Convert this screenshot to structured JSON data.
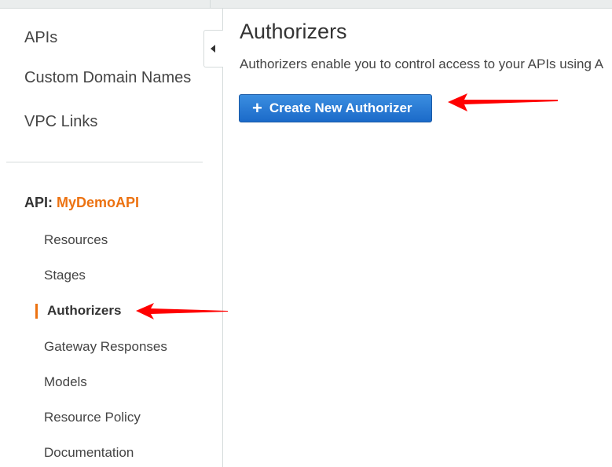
{
  "sidebar": {
    "top_links": [
      "APIs",
      "Custom Domain Names",
      "VPC Links"
    ],
    "api_prefix": "API:",
    "api_name": "MyDemoAPI",
    "sub_items": [
      "Resources",
      "Stages",
      "Authorizers",
      "Gateway Responses",
      "Models",
      "Resource Policy",
      "Documentation"
    ],
    "active_item": "Authorizers"
  },
  "main": {
    "title": "Authorizers",
    "description": "Authorizers enable you to control access to your APIs using A",
    "create_button_label": "Create New Authorizer",
    "create_button_icon": "plus-icon"
  },
  "colors": {
    "accent_orange": "#ec7211",
    "button_blue": "#1b6ac9",
    "annotation_red": "#ff0000"
  }
}
